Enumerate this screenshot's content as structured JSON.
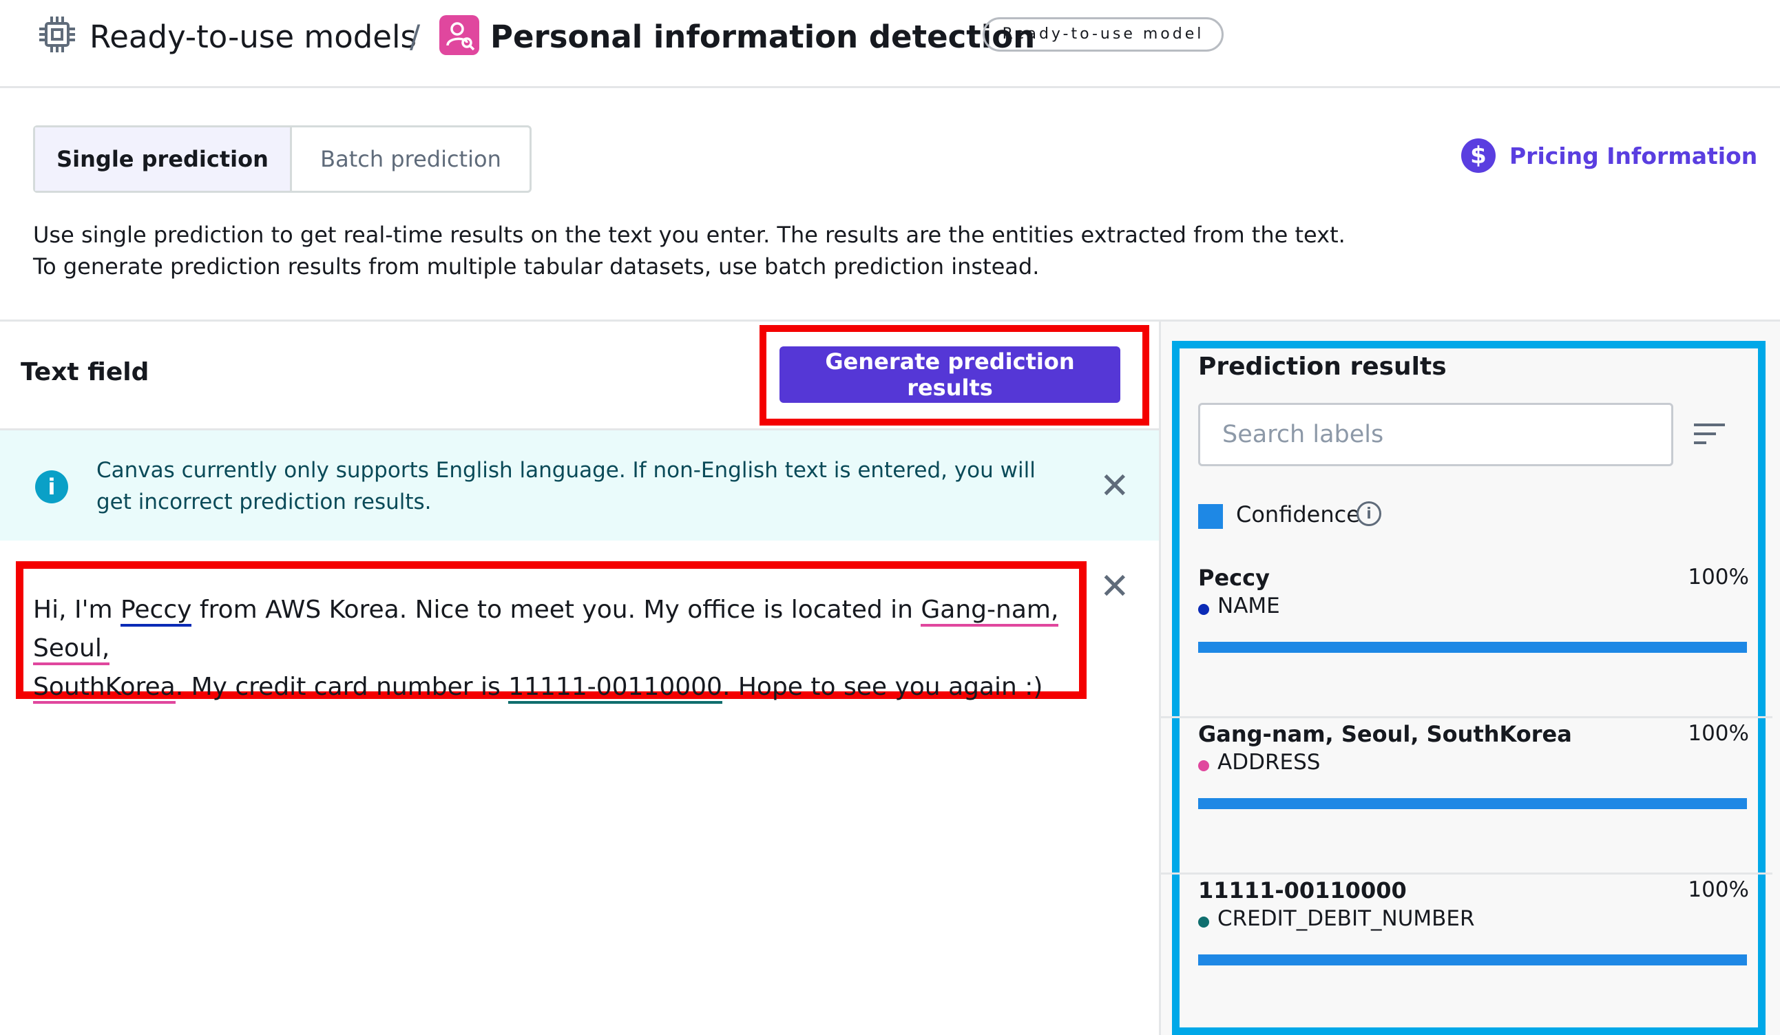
{
  "header": {
    "breadcrumb_root": "Ready-to-use models",
    "breadcrumb_separator": "/",
    "title": "Personal information detection",
    "badge": "Ready-to-use model",
    "root_icon": "chip-icon",
    "app_icon": "person-search-icon"
  },
  "tabs": [
    {
      "label": "Single prediction",
      "active": true
    },
    {
      "label": "Batch prediction",
      "active": false
    }
  ],
  "pricing": {
    "label": "Pricing Information",
    "icon": "dollar-icon"
  },
  "description": {
    "line1": "Use single prediction to get real-time results on the text you enter. The results are the entities extracted from the text.",
    "line2": "To generate prediction results from multiple tabular datasets, use batch prediction instead."
  },
  "text_field": {
    "label": "Text field",
    "generate_button": "Generate prediction results",
    "alert": "Canvas currently only supports English language. If non-English text is entered, you will get incorrect prediction results.",
    "input": {
      "segments": [
        "Hi, I'm ",
        "Peccy",
        " from AWS Korea. Nice to meet you. My office is located in ",
        "Gang-nam, Seoul,",
        " ",
        "SouthKorea",
        ". My credit card number is ",
        "11111-00110000",
        ". Hope to see you again :)"
      ]
    }
  },
  "prediction_results": {
    "title": "Prediction results",
    "search_placeholder": "Search labels",
    "legend": "Confidence",
    "results": [
      {
        "entity": "Peccy",
        "label": "NAME",
        "confidence": "100%",
        "confidence_value": 1.0,
        "color": "#0b2bb6"
      },
      {
        "entity": "Gang-nam, Seoul, SouthKorea",
        "label": "ADDRESS",
        "confidence": "100%",
        "confidence_value": 1.0,
        "color": "#e0479e"
      },
      {
        "entity": "11111-00110000",
        "label": "CREDIT_DEBIT_NUMBER",
        "confidence": "100%",
        "confidence_value": 1.0,
        "color": "#0f6e6e"
      }
    ],
    "bar_color": "#1e88e5"
  },
  "colors": {
    "accent": "#5537d6",
    "highlight_outline": "#f40000",
    "results_outline": "#00a8e8",
    "info": "#0aa0c7"
  }
}
